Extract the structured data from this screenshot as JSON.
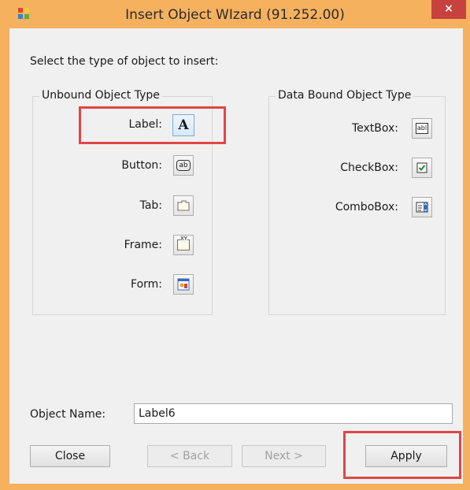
{
  "window": {
    "title": "Insert Object WIzard (91.252.00)",
    "close_glyph": "×"
  },
  "prompt": "Select the type of object to insert:",
  "unbound": {
    "legend": "Unbound Object Type",
    "items": [
      {
        "label": "Label:",
        "icon": "label-icon"
      },
      {
        "label": "Button:",
        "icon": "button-icon"
      },
      {
        "label": "Tab:",
        "icon": "tab-icon"
      },
      {
        "label": "Frame:",
        "icon": "frame-icon"
      },
      {
        "label": "Form:",
        "icon": "form-icon"
      }
    ]
  },
  "bound": {
    "legend": "Data Bound Object Type",
    "items": [
      {
        "label": "TextBox:",
        "icon": "textbox-icon"
      },
      {
        "label": "CheckBox:",
        "icon": "checkbox-icon"
      },
      {
        "label": "ComboBox:",
        "icon": "combobox-icon"
      }
    ]
  },
  "icon_text": {
    "label": "A",
    "button": "ab",
    "textbox": "abl",
    "frame": "XY"
  },
  "object_name": {
    "label": "Object Name:",
    "value": "Label6"
  },
  "buttons": {
    "close": "Close",
    "back": "< Back",
    "next": "Next >",
    "apply": "Apply"
  },
  "colors": {
    "accent": "#f6b15f",
    "highlight": "#e04646",
    "close_button": "#c7413e"
  }
}
